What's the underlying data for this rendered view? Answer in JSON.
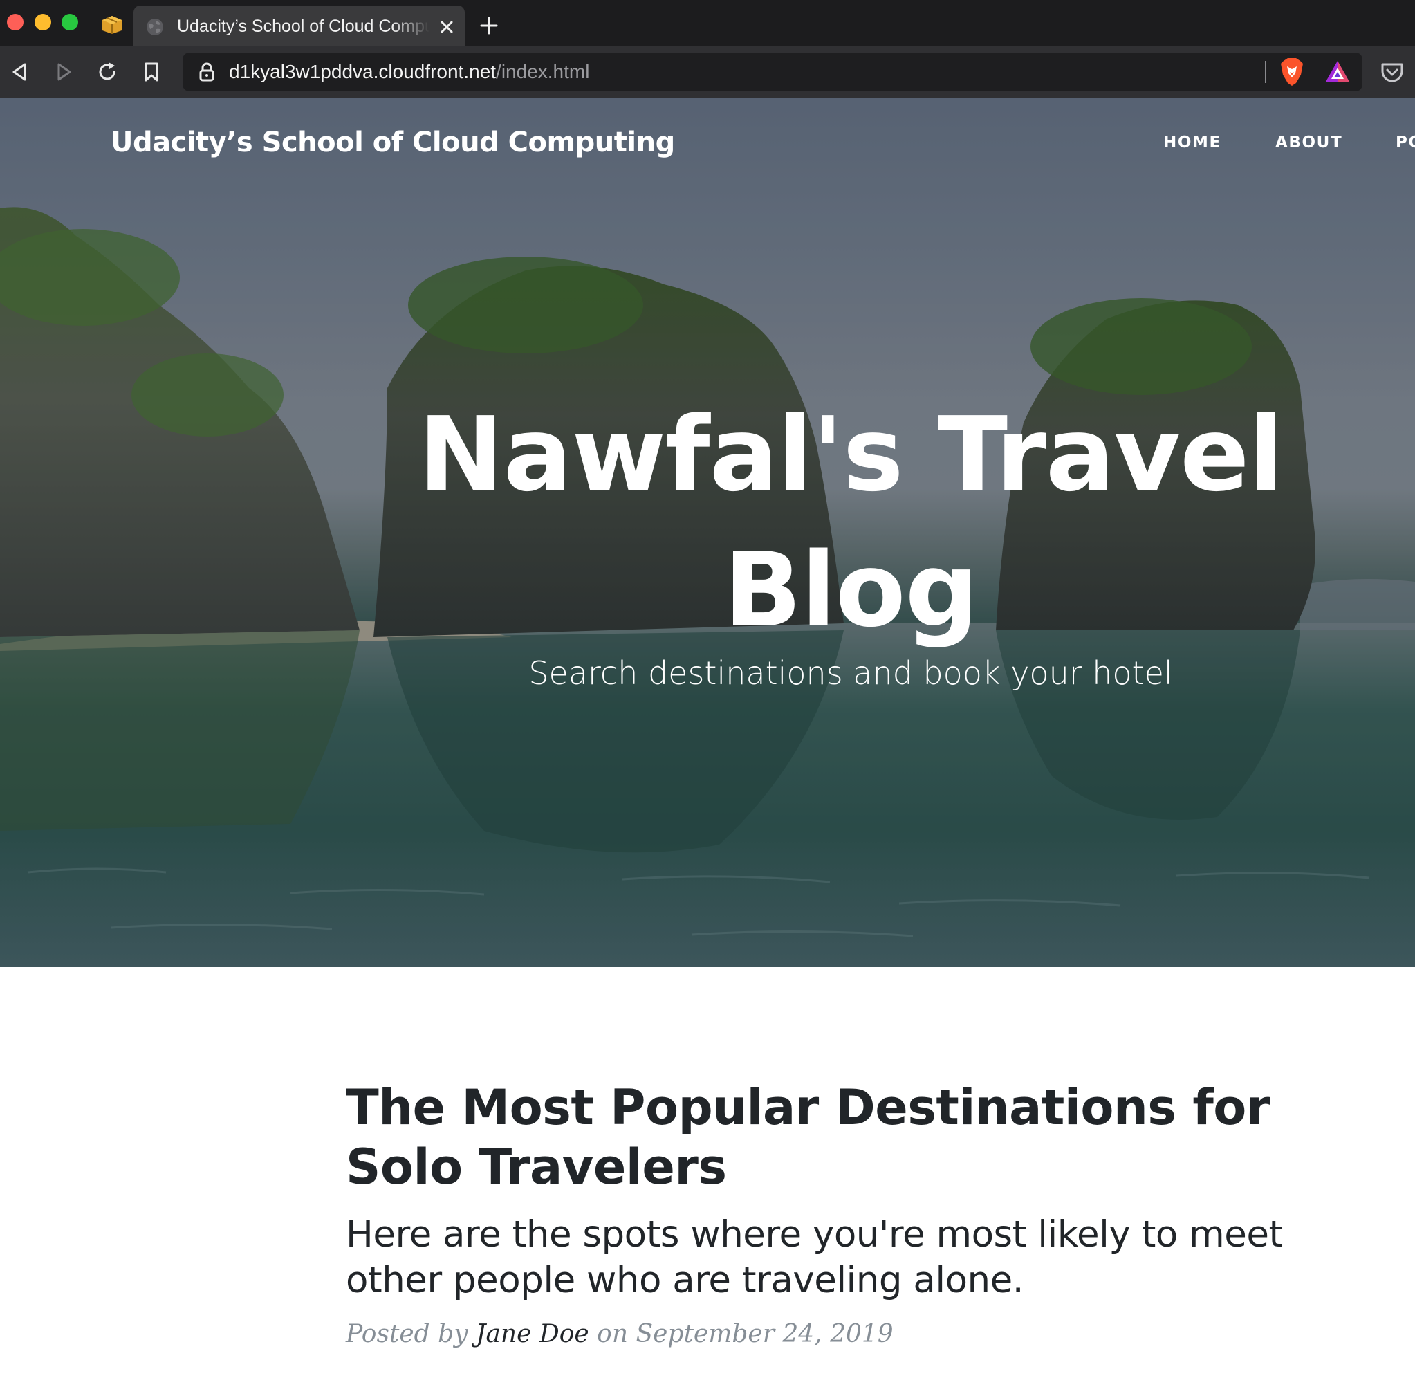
{
  "browser": {
    "tab_title": "Udacity’s School of Cloud Computing",
    "url_host": "d1kyal3w1pddva.cloudfront.net",
    "url_path": "/index.html"
  },
  "site": {
    "brand": "Udacity’s School of Cloud Computing",
    "nav": {
      "home": "HOME",
      "about": "ABOUT",
      "posts": "POSTS"
    }
  },
  "hero": {
    "title": "Nawfal's Travel Blog",
    "subtitle": "Search destinations and book your hotel"
  },
  "post": {
    "title": "The Most Popular Destinations for Solo Travelers",
    "subtitle": "Here are the spots where you're most likely to meet other people who are traveling alone.",
    "meta_prefix": "Posted by",
    "author": "Jane Doe",
    "meta_on": "on",
    "date": "September 24, 2019"
  },
  "colors": {
    "text_dark": "#212529",
    "text_muted": "#868e96",
    "chrome_dark": "#1c1c1e",
    "chrome_toolbar": "#303033"
  },
  "icons": [
    "back-icon",
    "forward-icon",
    "reload-icon",
    "bookmark-icon",
    "lock-icon",
    "brave-shields-icon",
    "brave-rewards-icon",
    "pocket-icon",
    "close-icon",
    "plus-icon",
    "globe-icon",
    "package-icon"
  ]
}
